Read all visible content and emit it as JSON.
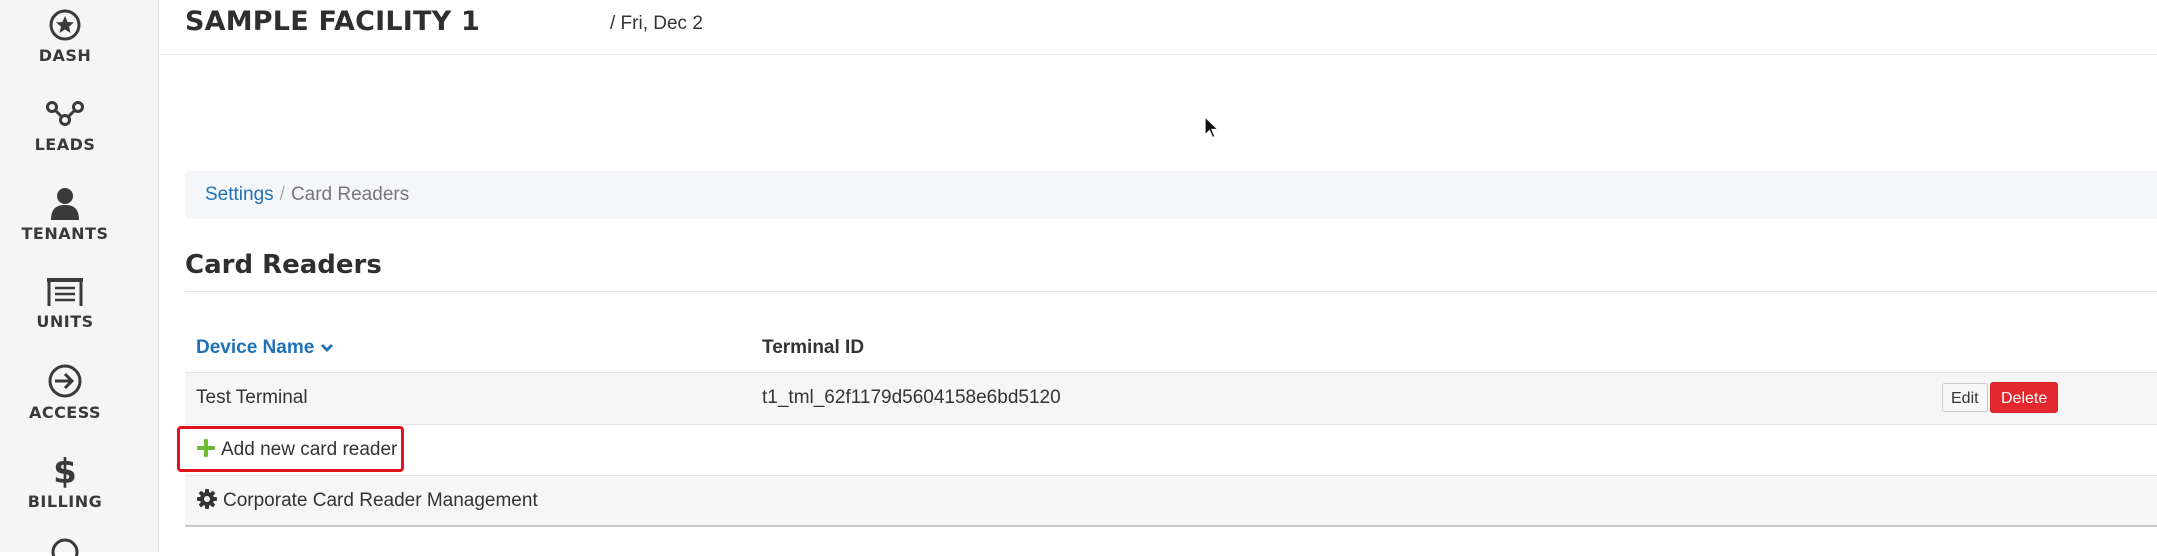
{
  "sidebar": {
    "items": [
      {
        "label": "DASH",
        "icon": "star-circle-icon"
      },
      {
        "label": "LEADS",
        "icon": "leads-network-icon"
      },
      {
        "label": "TENANTS",
        "icon": "person-icon"
      },
      {
        "label": "UNITS",
        "icon": "storage-unit-icon"
      },
      {
        "label": "ACCESS",
        "icon": "access-arrow-icon"
      },
      {
        "label": "BILLING",
        "icon": "dollar-icon"
      }
    ]
  },
  "header": {
    "facility": "SAMPLE FACILITY 1",
    "date": "/ Fri, Dec 2"
  },
  "breadcrumb": {
    "parent": "Settings",
    "separator": "/",
    "current": "Card Readers"
  },
  "page": {
    "title": "Card Readers"
  },
  "table": {
    "columns": {
      "device_name": "Device Name",
      "terminal_id": "Terminal ID"
    },
    "rows": [
      {
        "device_name": "Test Terminal",
        "terminal_id": "t1_tml_62f1179d5604158e6bd5120"
      }
    ],
    "actions": {
      "edit": "Edit",
      "delete": "Delete"
    }
  },
  "add_link": "Add new card reader",
  "corporate_link": "Corporate Card Reader Management",
  "colors": {
    "link": "#1f72b8",
    "delete": "#e3292f",
    "plus": "#6fb935",
    "highlight": "#e3111b"
  }
}
